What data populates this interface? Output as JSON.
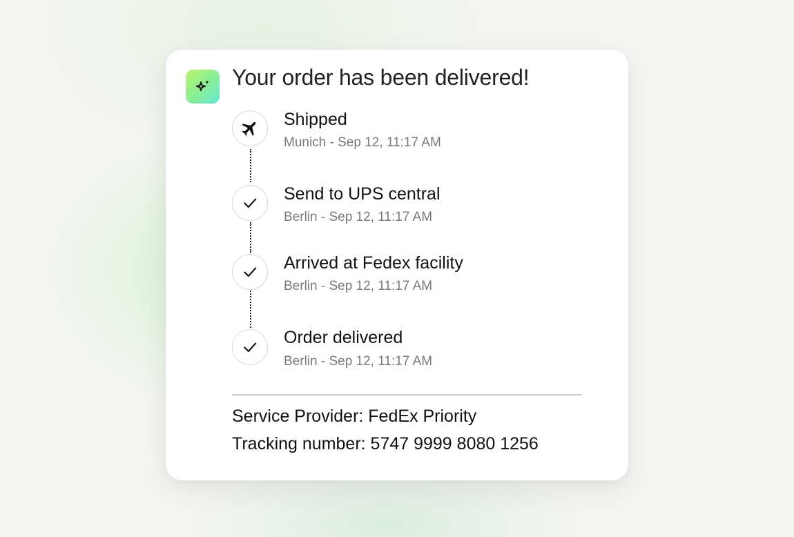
{
  "notification": {
    "app_icon": "sparkles-icon",
    "title": "Your order has been delivered!",
    "steps": [
      {
        "icon": "airplane-icon",
        "title": "Shipped",
        "detail": "Munich - Sep 12, 11:17 AM"
      },
      {
        "icon": "checkmark-icon",
        "title": "Send to UPS central",
        "detail": "Berlin - Sep 12, 11:17 AM"
      },
      {
        "icon": "checkmark-icon",
        "title": "Arrived at Fedex facility",
        "detail": "Berlin - Sep 12, 11:17 AM"
      },
      {
        "icon": "checkmark-icon",
        "title": "Order delivered",
        "detail": "Berlin - Sep 12, 11:17 AM"
      }
    ],
    "service_provider": "Service Provider: FedEx Priority",
    "tracking_number": "Tracking number: 5747 9999 8080 1256"
  },
  "colors": {
    "card": "#ffffff",
    "badge_gradient_start": "#b8f36a",
    "badge_gradient_end": "#63e7d2",
    "text_primary": "#111111",
    "text_secondary": "#7a7a7a"
  }
}
